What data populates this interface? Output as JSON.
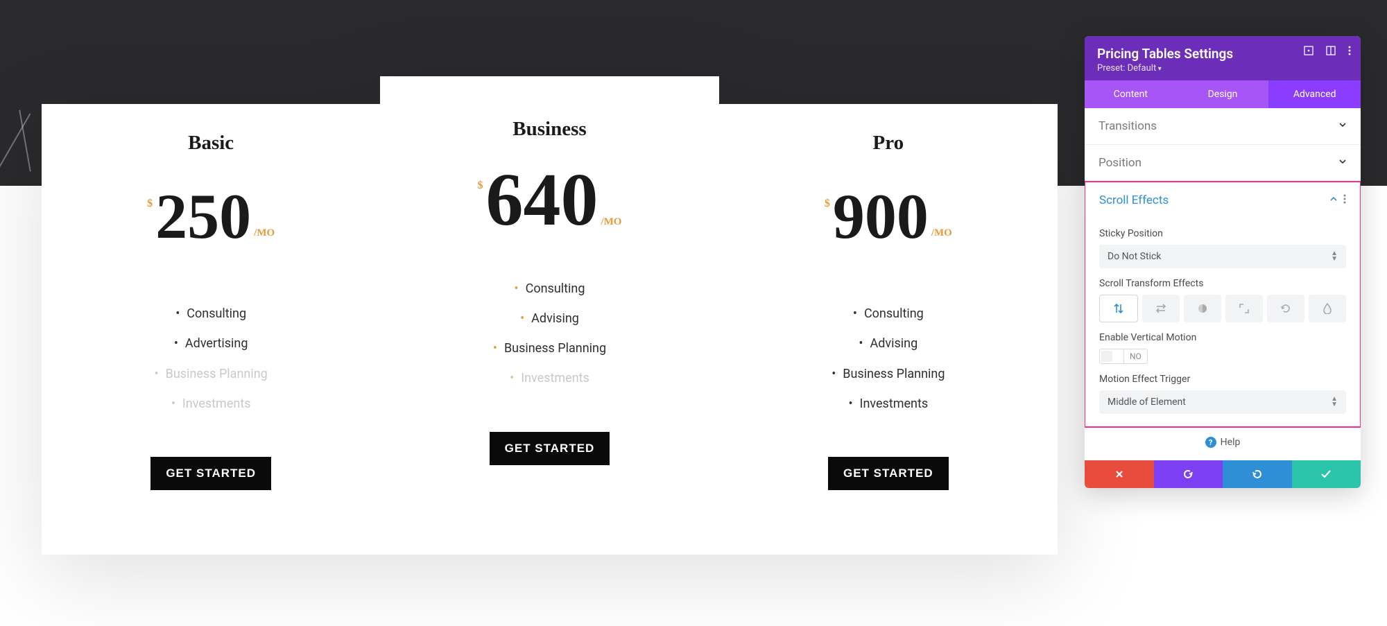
{
  "pricing": {
    "plans": [
      {
        "title": "Basic",
        "currency": "$",
        "price": "250",
        "period": "/MO",
        "features": [
          {
            "label": "Consulting",
            "dim": false
          },
          {
            "label": "Advertising",
            "dim": false
          },
          {
            "label": "Business Planning",
            "dim": true
          },
          {
            "label": "Investments",
            "dim": true
          }
        ],
        "cta": "GET STARTED"
      },
      {
        "title": "Business",
        "currency": "$",
        "price": "640",
        "period": "/MO",
        "featured": true,
        "features": [
          {
            "label": "Consulting",
            "dim": false
          },
          {
            "label": "Advising",
            "dim": false
          },
          {
            "label": "Business Planning",
            "dim": false
          },
          {
            "label": "Investments",
            "dim": true
          }
        ],
        "cta": "GET STARTED"
      },
      {
        "title": "Pro",
        "currency": "$",
        "price": "900",
        "period": "/MO",
        "features": [
          {
            "label": "Consulting",
            "dim": false
          },
          {
            "label": "Advising",
            "dim": false
          },
          {
            "label": "Business Planning",
            "dim": false
          },
          {
            "label": "Investments",
            "dim": false
          }
        ],
        "cta": "GET STARTED"
      }
    ]
  },
  "panel": {
    "title": "Pricing Tables Settings",
    "preset": "Preset: Default",
    "tabs": {
      "content": "Content",
      "design": "Design",
      "advanced": "Advanced",
      "active": "advanced"
    },
    "sections": {
      "transitions": "Transitions",
      "position": "Position",
      "scroll_effects": "Scroll Effects"
    },
    "fields": {
      "sticky_label": "Sticky Position",
      "sticky_value": "Do Not Stick",
      "transform_label": "Scroll Transform Effects",
      "vertical_label": "Enable Vertical Motion",
      "vertical_value": "NO",
      "trigger_label": "Motion Effect Trigger",
      "trigger_value": "Middle of Element"
    },
    "help": "Help"
  }
}
